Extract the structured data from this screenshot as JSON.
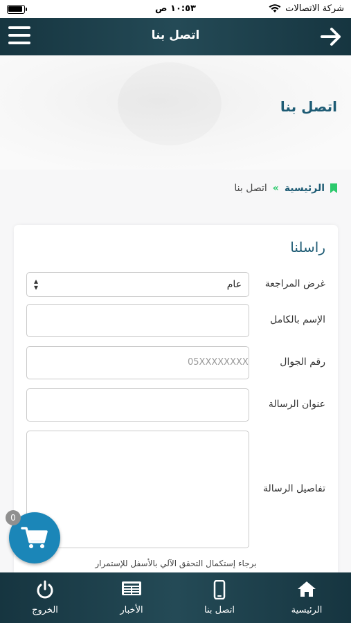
{
  "status_bar": {
    "carrier": "شركة الاتصالات",
    "time": "١٠:٥٣ ص"
  },
  "header": {
    "title": "اتصل بنا",
    "back_icon": "arrow-right-icon",
    "menu_icon": "hamburger-menu-icon"
  },
  "hero": {
    "title": "اتصل بنا"
  },
  "breadcrumb": {
    "home": "الرئيسية",
    "separator": "»",
    "current": "اتصل بنا"
  },
  "form": {
    "title": "راسلنا",
    "purpose_label": "غرض المراجعة",
    "purpose_value": "عام",
    "name_label": "الإسم بالكامل",
    "name_value": "",
    "mobile_label": "رقم الجوال",
    "mobile_placeholder": "05XXXXXXXX",
    "subject_label": "عنوان الرسالة",
    "subject_value": "",
    "details_label": "تفاصيل الرسالة",
    "details_value": "",
    "captcha_note": "برجاء إستكمال التحقق الآلي بالأسفل للإستمرار"
  },
  "cart": {
    "count": "0",
    "icon": "shopping-cart-icon"
  },
  "bottom_nav": [
    {
      "label": "الرئيسية",
      "icon": "home-icon"
    },
    {
      "label": "اتصل بنا",
      "icon": "mobile-phone-icon"
    },
    {
      "label": "الأخبار",
      "icon": "newspaper-icon"
    },
    {
      "label": "الخروج",
      "icon": "power-icon"
    }
  ],
  "colors": {
    "header_bg": "#1f434e",
    "accent": "#1d5b74",
    "green": "#2cc96c",
    "fab": "#1b86b8"
  }
}
